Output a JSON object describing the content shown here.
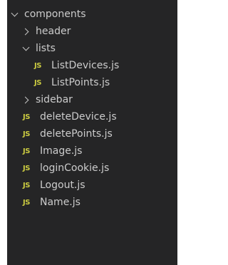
{
  "explorer": {
    "items": [
      {
        "type": "folder",
        "label": "components",
        "expanded": true,
        "depth": 0
      },
      {
        "type": "folder",
        "label": "header",
        "expanded": false,
        "depth": 1
      },
      {
        "type": "folder",
        "label": "lists",
        "expanded": true,
        "depth": 1
      },
      {
        "type": "file",
        "icon_text": "JS",
        "label": "ListDevices.js",
        "depth": 2
      },
      {
        "type": "file",
        "icon_text": "JS",
        "label": "ListPoints.js",
        "depth": 2
      },
      {
        "type": "folder",
        "label": "sidebar",
        "expanded": false,
        "depth": 1
      },
      {
        "type": "file",
        "icon_text": "JS",
        "label": "deleteDevice.js",
        "depth": 1
      },
      {
        "type": "file",
        "icon_text": "JS",
        "label": "deletePoints.js",
        "depth": 1
      },
      {
        "type": "file",
        "icon_text": "JS",
        "label": "Image.js",
        "depth": 1
      },
      {
        "type": "file",
        "icon_text": "JS",
        "label": "loginCookie.js",
        "depth": 1
      },
      {
        "type": "file",
        "icon_text": "JS",
        "label": "Logout.js",
        "depth": 1
      },
      {
        "type": "file",
        "icon_text": "JS",
        "label": "Name.js",
        "depth": 1
      }
    ]
  },
  "colors": {
    "background": "#252526",
    "text": "#cccccc",
    "js_icon": "#cbcb41"
  }
}
